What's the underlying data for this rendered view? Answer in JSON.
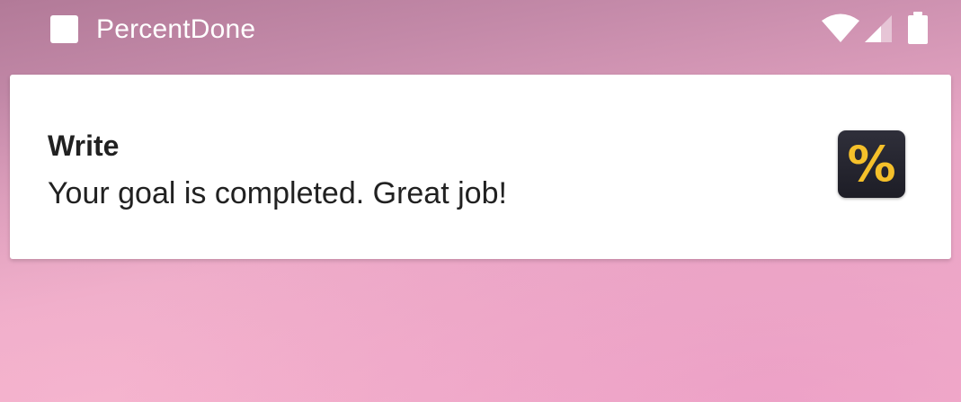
{
  "status_bar": {
    "app_name": "PercentDone",
    "icons": [
      "app-square-icon",
      "wifi-icon",
      "cell-signal-icon",
      "battery-icon"
    ]
  },
  "notification": {
    "title": "Write",
    "text": "Your goal is completed. Great job!",
    "icon_name": "percent-icon",
    "icon_glyph": "%"
  },
  "colors": {
    "background_top": "#b27a98",
    "background_bottom": "#f4b1cc",
    "card": "#ffffff",
    "text": "#212121",
    "icon_bg": "#1d1d26",
    "icon_accent": "#f5c02a"
  }
}
